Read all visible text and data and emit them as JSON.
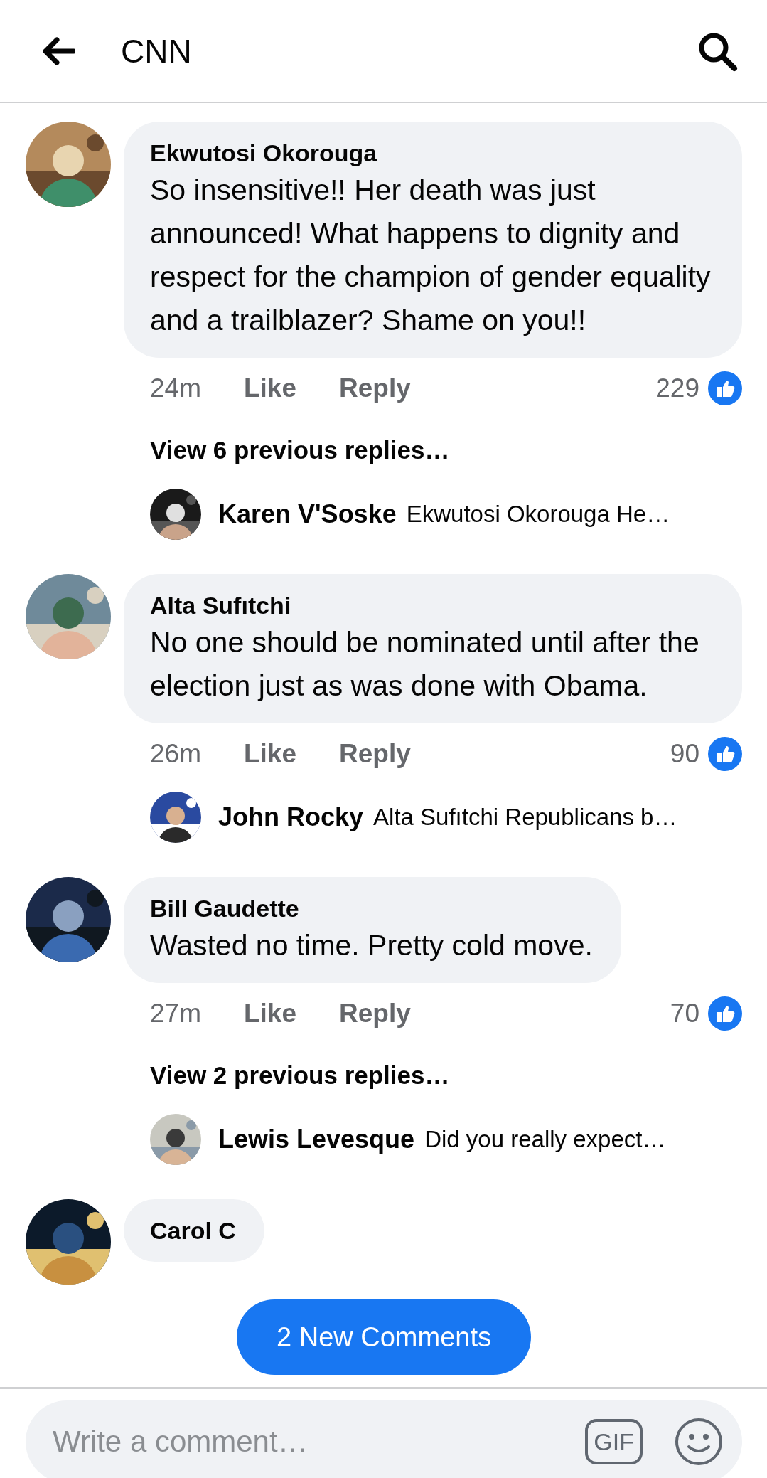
{
  "header": {
    "title": "CNN"
  },
  "comments": [
    {
      "name": "Ekwutosi Okorouga",
      "text": "So insensitive!! Her death was just announced! What happens to dignity and respect for the champion of gender equality and a trailblazer? Shame on you!!",
      "time": "24m",
      "like": "Like",
      "reply": "Reply",
      "reactions": "229",
      "view_replies": "View 6 previous replies…",
      "reply_preview": {
        "name": "Karen V'Soske",
        "text": "Ekwutosi Okorouga He…"
      }
    },
    {
      "name": "Alta Sufıtchi",
      "text": "No one should be nominated until after the election just as was done with Obama.",
      "time": "26m",
      "like": "Like",
      "reply": "Reply",
      "reactions": "90",
      "reply_preview": {
        "name": "John Rocky",
        "text": "Alta Sufıtchi Republicans b…"
      }
    },
    {
      "name": "Bill Gaudette",
      "text": "Wasted no time. Pretty cold move.",
      "time": "27m",
      "like": "Like",
      "reply": "Reply",
      "reactions": "70",
      "view_replies": "View 2 previous replies…",
      "reply_preview": {
        "name": "Lewis Levesque",
        "text": "Did you really expect…"
      }
    },
    {
      "name": "Carol C"
    }
  ],
  "new_comments_button": "2 New Comments",
  "composer": {
    "placeholder": "Write a comment…",
    "gif": "GIF"
  }
}
